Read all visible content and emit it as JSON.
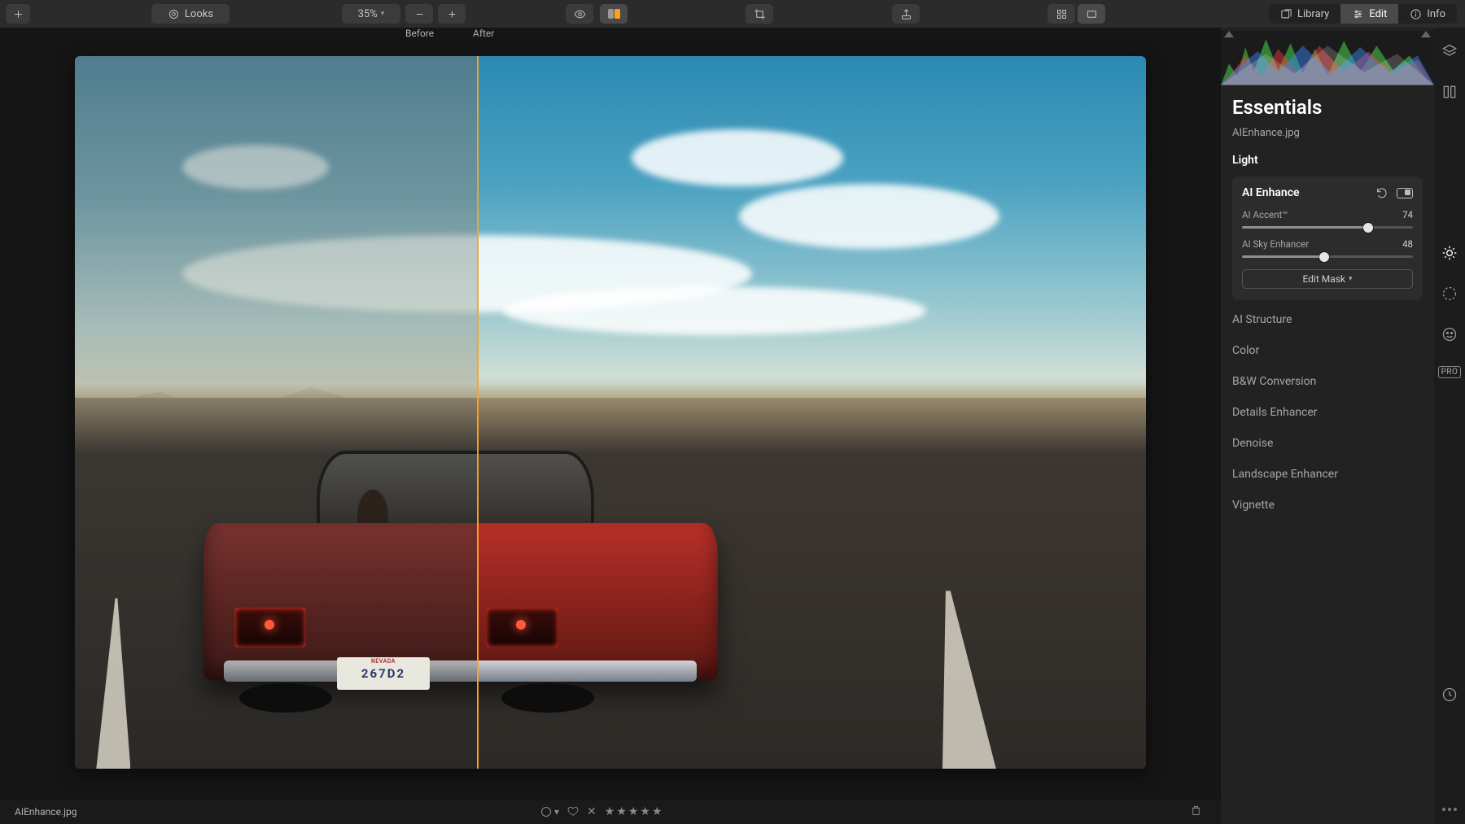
{
  "toolbar": {
    "looks_label": "Looks",
    "zoom_pct": "35%"
  },
  "mode_tabs": {
    "library": "Library",
    "edit": "Edit",
    "info": "Info"
  },
  "compare": {
    "before": "Before",
    "after": "After"
  },
  "file": {
    "name": "AIEnhance.jpg",
    "plate_state": "NEVADA",
    "plate_number": "267D2"
  },
  "footer": {
    "stars": "★★★★★"
  },
  "panel": {
    "title": "Essentials",
    "sections": {
      "light": "Light",
      "ai_structure": "AI Structure",
      "color": "Color",
      "bw": "B&W Conversion",
      "details": "Details Enhancer",
      "denoise": "Denoise",
      "landscape": "Landscape Enhancer",
      "vignette": "Vignette"
    },
    "ai_enhance": {
      "title": "AI Enhance",
      "accent_label": "AI Accent™",
      "accent_value": 74,
      "sky_label": "AI Sky Enhancer",
      "sky_value": 48,
      "edit_mask": "Edit Mask"
    },
    "pro_badge": "PRO"
  }
}
